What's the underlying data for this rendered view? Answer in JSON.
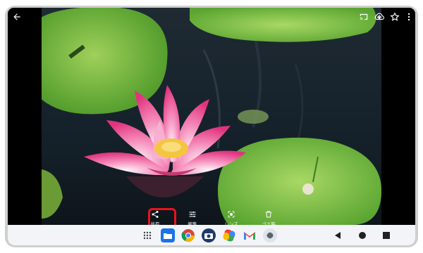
{
  "viewer": {
    "actions": [
      {
        "icon": "share-icon",
        "label": "共有"
      },
      {
        "icon": "edit-adjust-icon",
        "label": "編集"
      },
      {
        "icon": "lens-icon",
        "label": "レンズ"
      },
      {
        "icon": "trash-icon",
        "label": "ゴミ箱"
      }
    ]
  },
  "top_bar": {
    "icons": [
      "back-arrow-icon",
      "cast-icon",
      "cloud-upload-icon",
      "star-icon",
      "more-vert-icon"
    ]
  },
  "dock": {
    "apps": [
      "app-drawer-icon",
      "files-app-icon",
      "chrome-icon",
      "camera-icon",
      "photos-icon",
      "gmail-icon",
      "settings-icon"
    ]
  },
  "nav": [
    "back-triangle-icon",
    "home-circle-icon",
    "recents-square-icon"
  ],
  "colors": {
    "highlight": "#e8141c",
    "taskbar": "#f3f4f8"
  }
}
